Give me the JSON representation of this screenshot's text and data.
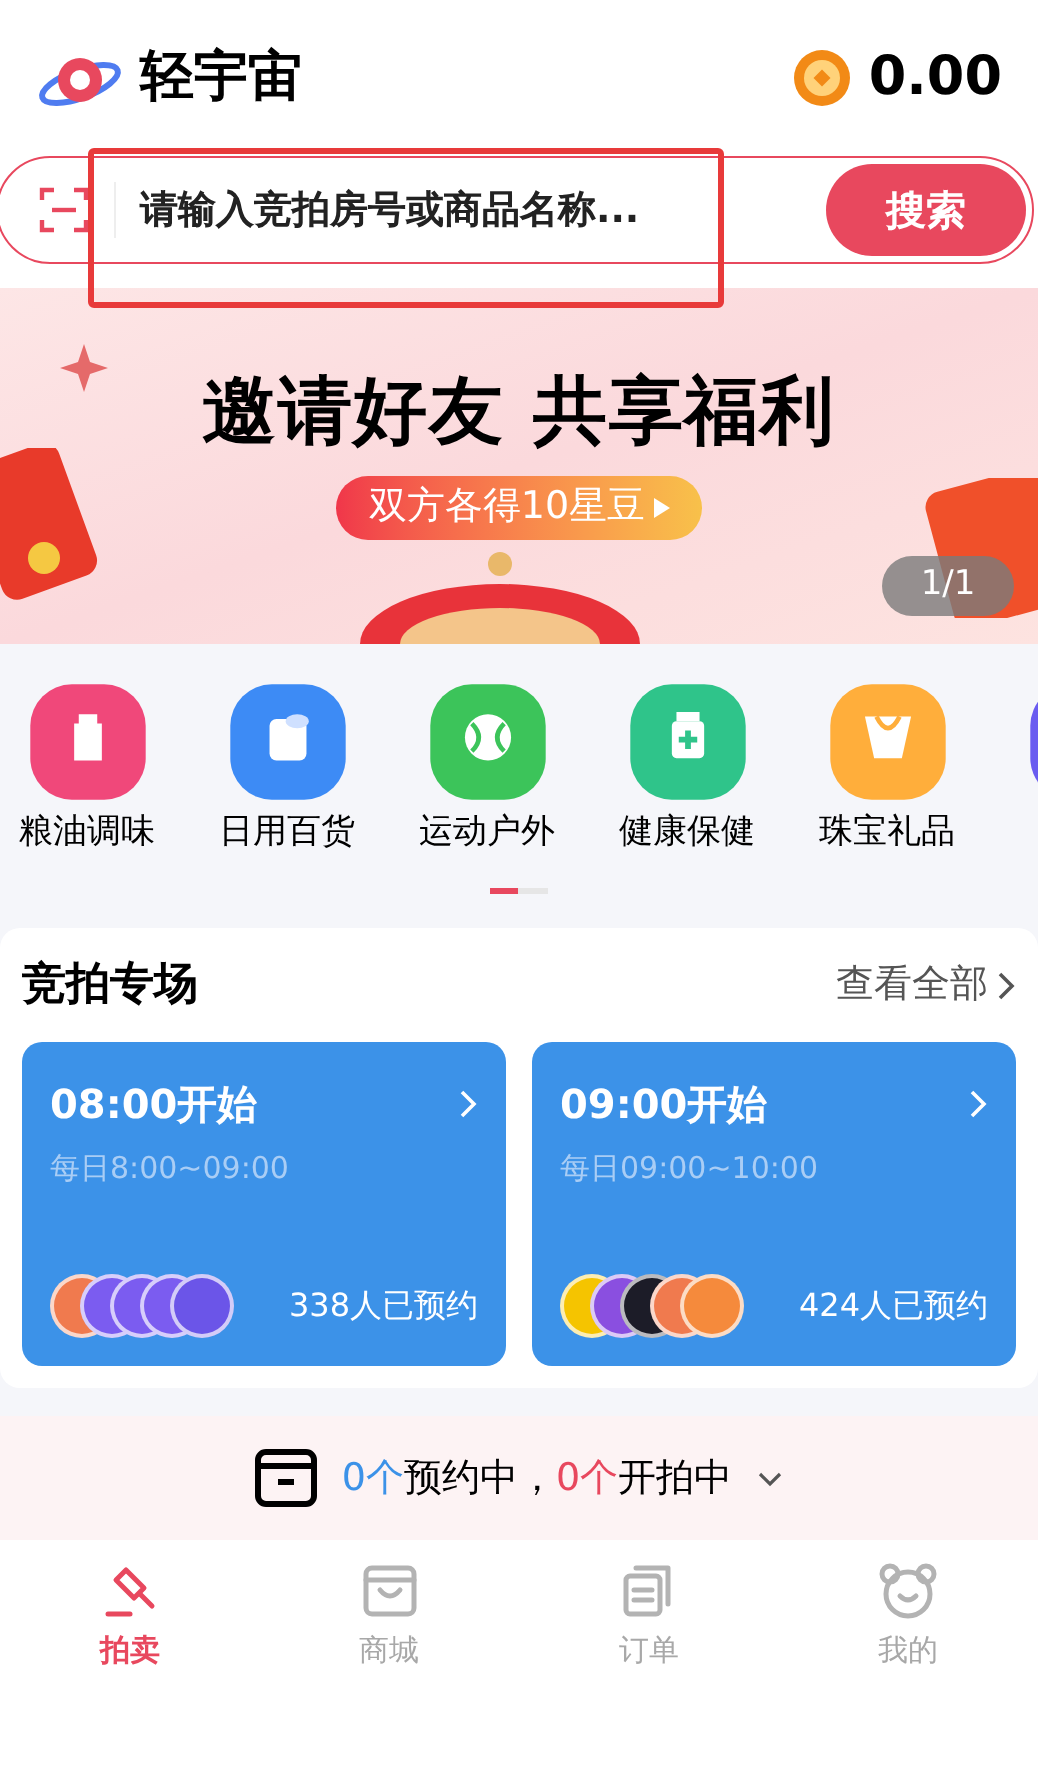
{
  "header": {
    "app_name": "轻宇宙",
    "balance": "0.00"
  },
  "search": {
    "placeholder": "请输入竞拍房号或商品名称...",
    "button": "搜索"
  },
  "banner": {
    "title": "邀请好友 共享福利",
    "cta": "双方各得10星豆",
    "page_indicator": "1/1"
  },
  "categories": [
    {
      "label": "粮油调味",
      "color": "#f0487a"
    },
    {
      "label": "日用百货",
      "color": "#3d8bf5"
    },
    {
      "label": "运动户外",
      "color": "#3cc45a"
    },
    {
      "label": "健康保健",
      "color": "#2fc48a"
    },
    {
      "label": "珠宝礼品",
      "color": "#ffae3b"
    },
    {
      "color": "#6a5cf0"
    }
  ],
  "auction": {
    "title": "竞拍专场",
    "view_all": "查看全部",
    "sessions": [
      {
        "title": "08:00开始",
        "time": "每日8:00~09:00",
        "count": "338人已预约",
        "avatars": [
          {
            "color": "#f07a4e"
          },
          {
            "color": "#7b5cf0"
          },
          {
            "color": "#7b5cf0"
          },
          {
            "color": "#7b5cf0"
          },
          {
            "color": "#6b55e8"
          }
        ]
      },
      {
        "title": "09:00开始",
        "time": "每日09:00~10:00",
        "count": "424人已预约",
        "avatars": [
          {
            "color": "#f5c400"
          },
          {
            "color": "#8a4fe0"
          },
          {
            "color": "#1c1c28"
          },
          {
            "color": "#f07a4e"
          },
          {
            "color": "#f58a3c"
          }
        ]
      }
    ]
  },
  "status_bar": {
    "reserved_count": "0个",
    "reserved_label": "预约中，",
    "live_count": "0个",
    "live_label": "开拍中"
  },
  "tabs": [
    {
      "label": "拍卖",
      "kind": "gavel",
      "selected": true
    },
    {
      "label": "商城",
      "kind": "shop",
      "selected": false
    },
    {
      "label": "订单",
      "kind": "orders",
      "selected": false
    },
    {
      "label": "我的",
      "kind": "profile",
      "selected": false
    }
  ]
}
